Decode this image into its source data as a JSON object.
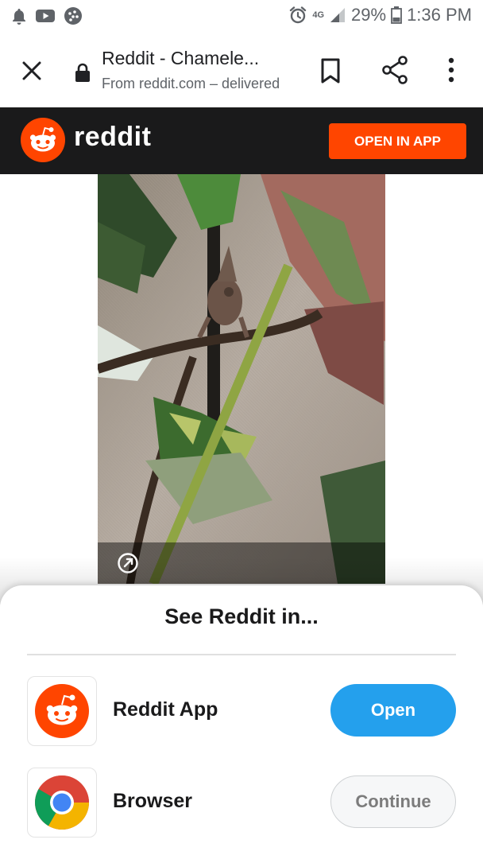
{
  "status_bar": {
    "icons_left": [
      "bell-icon",
      "youtube-icon",
      "dots-app-icon"
    ],
    "icons_right": [
      "alarm-icon",
      "lte-4g-icon",
      "signal-icon",
      "battery-icon"
    ],
    "network": "4G",
    "battery": "29%",
    "time": "1:36 PM"
  },
  "toolbar": {
    "title": "Reddit - Chamele...",
    "url": "From reddit.com – delivered",
    "icons": [
      "close-icon",
      "lock-icon",
      "bookmark-icon",
      "share-icon",
      "more-vert-icon"
    ]
  },
  "reddit_header": {
    "wordmark": "reddit",
    "open_in_app": "OPEN IN APP",
    "brand_color": "#ff4500",
    "bg_color": "#1a1a1b"
  },
  "media": {
    "image_subject": "chameleon",
    "link_icon": "external-link-icon"
  },
  "sheet": {
    "title": "See Reddit in...",
    "options": [
      {
        "label": "Reddit App",
        "button": "Open",
        "icon": "reddit-app-icon",
        "button_color": "#24a0ed"
      },
      {
        "label": "Browser",
        "button": "Continue",
        "icon": "chrome-icon"
      }
    ]
  }
}
